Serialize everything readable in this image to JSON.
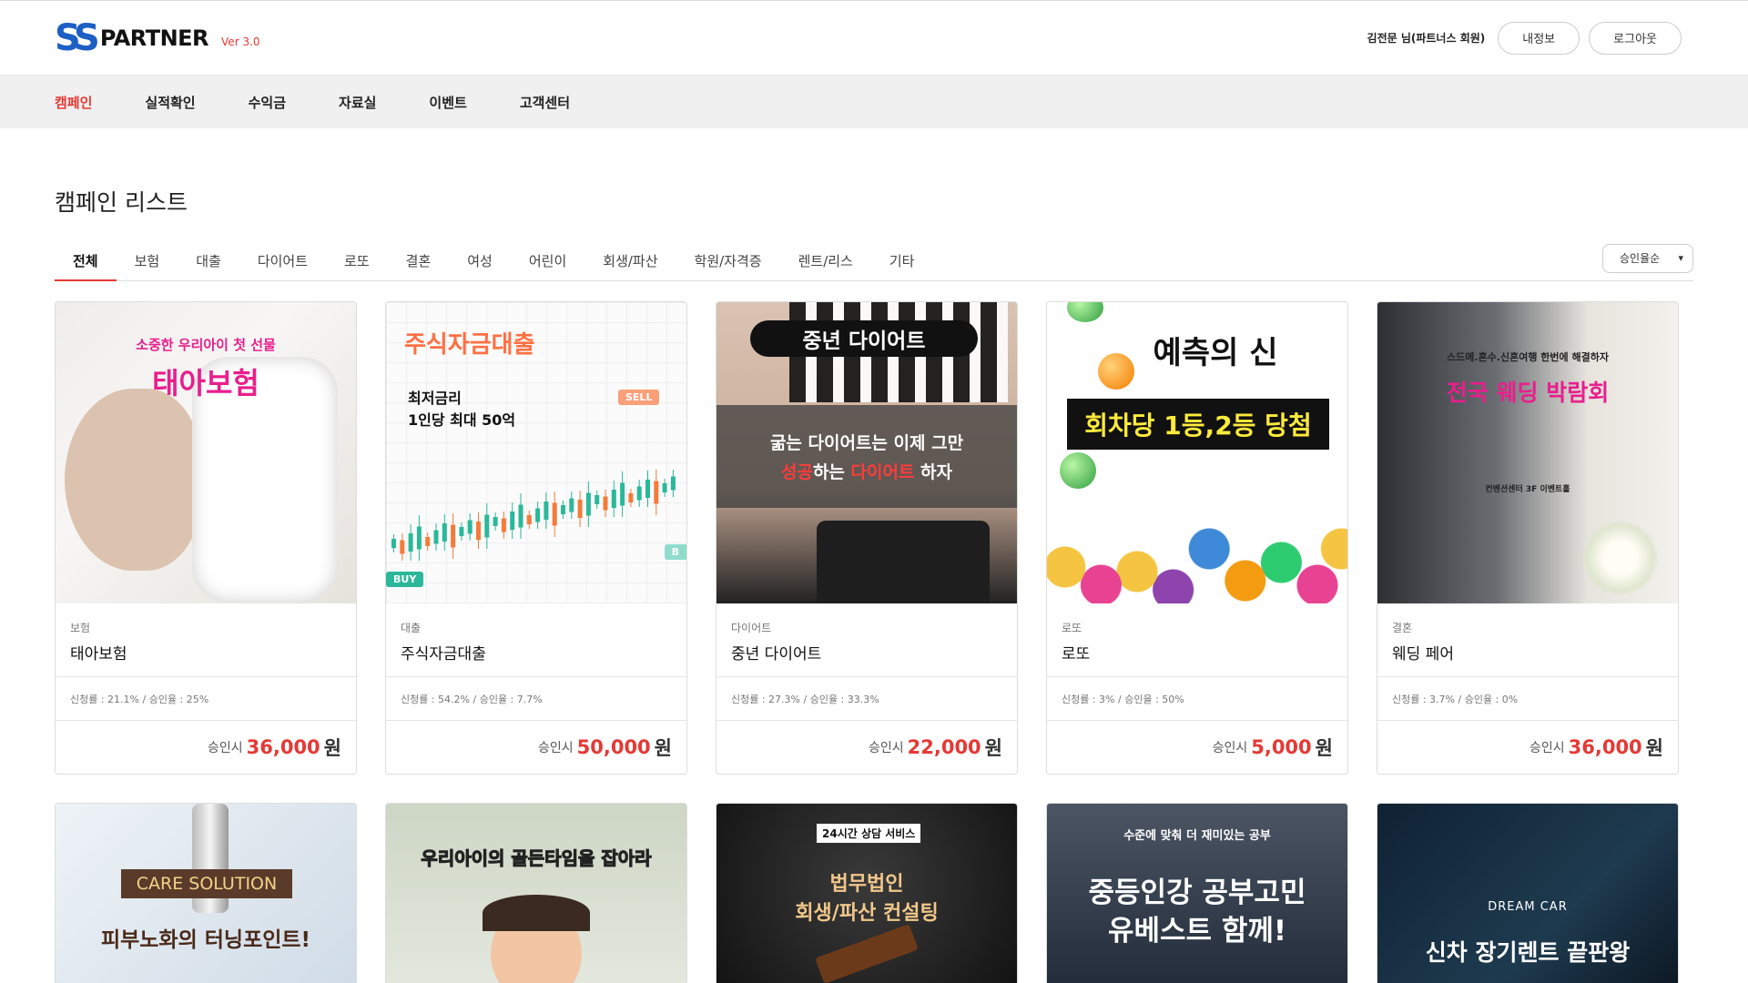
{
  "header": {
    "logo_mark": "SS",
    "logo_text": "PARTNER",
    "version": "Ver 3.0",
    "user": "김전문 님(파트너스 회원)",
    "myinfo": "내정보",
    "logout": "로그아웃"
  },
  "nav": [
    "캠페인",
    "실적확인",
    "수익금",
    "자료실",
    "이벤트",
    "고객센터"
  ],
  "page_title": "캠페인 리스트",
  "tabs": [
    "전체",
    "보험",
    "대출",
    "다이어트",
    "로또",
    "결혼",
    "여성",
    "어린이",
    "회생/파산",
    "학원/자격증",
    "렌트/리스",
    "기타"
  ],
  "sort": {
    "selected": "승인율순",
    "chevron": "▾"
  },
  "cards": [
    {
      "category": "보험",
      "name": "태아보험",
      "stats": "신청률 : 21.1% / 승인율 : 25%",
      "price_prefix": "승인시",
      "price": "36,000",
      "won": "원",
      "banner": {
        "line1": "소중한 우리아이 첫 선물",
        "line2": "태아보험"
      }
    },
    {
      "category": "대출",
      "name": "주식자금대출",
      "stats": "신청률 : 54.2% / 승인율 : 7.7%",
      "price_prefix": "승인시",
      "price": "50,000",
      "won": "원",
      "banner": {
        "line1": "주식자금대출",
        "line2": "최저금리",
        "line3": "1인당 최대 50억",
        "sell": "SELL",
        "buy": "BUY",
        "b": "B"
      }
    },
    {
      "category": "다이어트",
      "name": "중년 다이어트",
      "stats": "신청률 : 27.3% / 승인율 : 33.3%",
      "price_prefix": "승인시",
      "price": "22,000",
      "won": "원",
      "banner": {
        "line1": "중년 다이어트",
        "line2": "굶는 다이어트는 이제 그만",
        "line3a": "성공",
        "line3b": "하는 ",
        "line3c": "다이어트",
        "line3d": " 하자"
      }
    },
    {
      "category": "로또",
      "name": "로또",
      "stats": "신청률 : 3% / 승인율 : 50%",
      "price_prefix": "승인시",
      "price": "5,000",
      "won": "원",
      "banner": {
        "line1": "예측의 신",
        "line2": "회차당 1등,2등 당첨"
      }
    },
    {
      "category": "결혼",
      "name": "웨딩 페어",
      "stats": "신청률 : 3.7% / 승인율 : 0%",
      "price_prefix": "승인시",
      "price": "36,000",
      "won": "원",
      "banner": {
        "line1": "스드메.혼수.신혼여행 한번에 해결하자",
        "line2": "전국 웨딩 박람회",
        "line3": "컨벤션센터 3F 이벤트홀"
      }
    }
  ],
  "cards2": [
    {
      "line1": "CARE SOLUTION",
      "line2": "피부노화의 터닝포인트!"
    },
    {
      "line1": "우리아이의 골든타임을 잡아라"
    },
    {
      "line1": "24시간 상담 서비스",
      "line2": "법무법인",
      "line3": "회생/파산 컨설팅"
    },
    {
      "line1": "수준에 맞춰 더 재미있는 공부",
      "line2": "중등인강 공부고민",
      "line3": "유베스트 함께!"
    },
    {
      "line1": "DREAM CAR",
      "line2": "신차 장기렌트 끝판왕"
    }
  ],
  "colors": {
    "accent": "#e53935",
    "brand": "#1d5fc4"
  }
}
